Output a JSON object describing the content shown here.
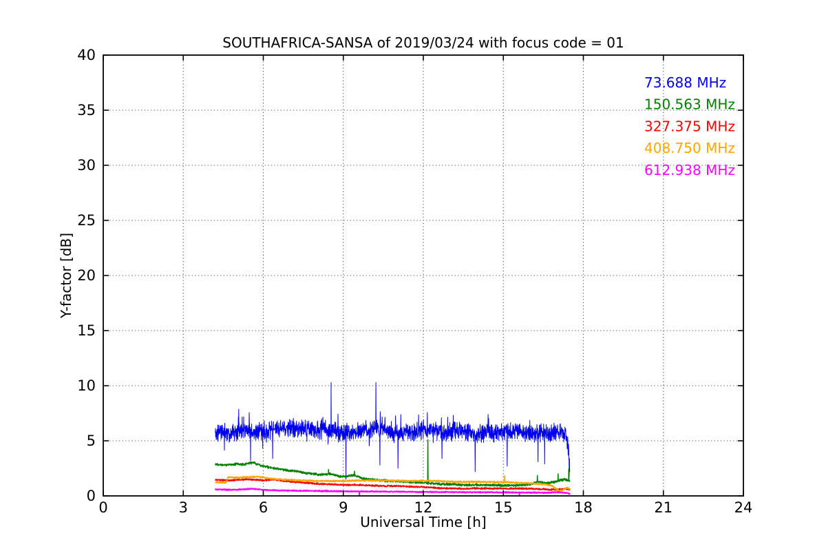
{
  "figure": {
    "background": "#ffffff",
    "axis_color": "#000000",
    "grid_color": "#4a4a4a"
  },
  "chart_data": {
    "type": "line",
    "title": "SOUTHAFRICA-SANSA of 2019/03/24 with focus code = 01",
    "xlabel": "Universal Time [h]",
    "ylabel": "Y-factor [dB]",
    "xlim": [
      0,
      24
    ],
    "ylim": [
      0,
      40
    ],
    "xticks": [
      0,
      3,
      6,
      9,
      12,
      15,
      18,
      21,
      24
    ],
    "yticks": [
      0,
      5,
      10,
      15,
      20,
      25,
      30,
      35,
      40
    ],
    "grid": true,
    "grid_style": "dotted",
    "legend": {
      "position": "top-right",
      "frame": false
    },
    "series": [
      {
        "name": "73.688 MHz",
        "color": "#0000ee",
        "line_width": 1.0,
        "x_range": [
          4.2,
          17.5
        ],
        "anchors": [
          [
            4.2,
            5.7
          ],
          [
            4.4,
            5.9
          ],
          [
            4.7,
            5.6
          ],
          [
            5.0,
            5.8
          ],
          [
            5.3,
            6.1
          ],
          [
            5.6,
            5.8
          ],
          [
            6.0,
            5.9
          ],
          [
            6.4,
            6.0
          ],
          [
            6.8,
            6.1
          ],
          [
            7.2,
            6.2
          ],
          [
            7.6,
            6.0
          ],
          [
            8.0,
            5.9
          ],
          [
            8.4,
            6.1
          ],
          [
            8.8,
            5.8
          ],
          [
            9.2,
            5.7
          ],
          [
            9.6,
            5.9
          ],
          [
            10.0,
            6.0
          ],
          [
            10.4,
            6.2
          ],
          [
            10.8,
            5.9
          ],
          [
            11.2,
            5.7
          ],
          [
            11.6,
            5.8
          ],
          [
            12.0,
            6.0
          ],
          [
            12.4,
            5.9
          ],
          [
            12.8,
            5.7
          ],
          [
            13.2,
            5.9
          ],
          [
            13.6,
            5.8
          ],
          [
            14.0,
            5.6
          ],
          [
            14.4,
            5.8
          ],
          [
            14.8,
            5.7
          ],
          [
            15.2,
            5.9
          ],
          [
            15.6,
            5.8
          ],
          [
            16.0,
            5.6
          ],
          [
            16.4,
            5.8
          ],
          [
            16.8,
            5.7
          ],
          [
            17.1,
            5.8
          ],
          [
            17.35,
            5.6
          ],
          [
            17.45,
            4.0
          ],
          [
            17.5,
            2.2
          ]
        ],
        "spikes": [
          [
            8.54,
            10.3
          ],
          [
            10.22,
            10.3
          ],
          [
            5.52,
            3.2
          ],
          [
            6.35,
            3.4
          ],
          [
            9.1,
            1.5
          ],
          [
            10.37,
            2.8
          ],
          [
            11.05,
            2.5
          ],
          [
            12.7,
            3.4
          ],
          [
            13.94,
            2.2
          ],
          [
            15.14,
            2.7
          ],
          [
            16.3,
            3.1
          ],
          [
            16.55,
            2.9
          ],
          [
            17.47,
            1.8
          ]
        ],
        "render": {
          "seed": 11,
          "points_per_hour": 140,
          "noise": 0.95,
          "burst": true
        }
      },
      {
        "name": "150.563 MHz",
        "color": "#008000",
        "line_width": 1.5,
        "x_range": [
          4.2,
          17.5
        ],
        "anchors": [
          [
            4.2,
            2.9
          ],
          [
            4.6,
            2.8
          ],
          [
            5.0,
            2.9
          ],
          [
            5.3,
            2.85
          ],
          [
            5.6,
            3.05
          ],
          [
            5.75,
            2.9
          ],
          [
            6.0,
            2.7
          ],
          [
            6.3,
            2.55
          ],
          [
            6.7,
            2.4
          ],
          [
            7.0,
            2.3
          ],
          [
            7.4,
            2.15
          ],
          [
            7.8,
            2.0
          ],
          [
            8.2,
            1.95
          ],
          [
            8.5,
            2.0
          ],
          [
            8.8,
            1.8
          ],
          [
            9.1,
            1.75
          ],
          [
            9.4,
            1.9
          ],
          [
            9.7,
            1.6
          ],
          [
            10.0,
            1.5
          ],
          [
            10.4,
            1.4
          ],
          [
            10.8,
            1.35
          ],
          [
            11.2,
            1.3
          ],
          [
            11.6,
            1.25
          ],
          [
            12.0,
            1.2
          ],
          [
            12.5,
            1.1
          ],
          [
            13.0,
            1.05
          ],
          [
            13.5,
            1.0
          ],
          [
            14.0,
            1.0
          ],
          [
            14.5,
            0.98
          ],
          [
            15.0,
            0.95
          ],
          [
            15.5,
            0.95
          ],
          [
            16.0,
            1.05
          ],
          [
            16.3,
            1.3
          ],
          [
            16.6,
            1.15
          ],
          [
            16.9,
            1.25
          ],
          [
            17.1,
            1.4
          ],
          [
            17.3,
            1.5
          ],
          [
            17.5,
            1.35
          ]
        ],
        "spikes": [
          [
            8.45,
            2.4
          ],
          [
            9.42,
            2.25
          ],
          [
            12.17,
            5.1
          ],
          [
            16.28,
            1.85
          ],
          [
            17.05,
            2.0
          ],
          [
            17.45,
            2.45
          ]
        ],
        "render": {
          "seed": 22,
          "points_per_hour": 130,
          "noise": 0.13,
          "burst": false
        }
      },
      {
        "name": "327.375 MHz",
        "color": "#ff0000",
        "line_width": 1.6,
        "x_range": [
          4.2,
          17.5
        ],
        "anchors": [
          [
            4.2,
            1.45
          ],
          [
            4.7,
            1.4
          ],
          [
            5.0,
            1.45
          ],
          [
            5.5,
            1.5
          ],
          [
            6.0,
            1.4
          ],
          [
            6.4,
            1.5
          ],
          [
            6.8,
            1.35
          ],
          [
            7.2,
            1.25
          ],
          [
            7.6,
            1.2
          ],
          [
            8.0,
            1.1
          ],
          [
            8.5,
            1.05
          ],
          [
            9.0,
            1.0
          ],
          [
            9.5,
            1.0
          ],
          [
            10.0,
            0.95
          ],
          [
            10.5,
            0.9
          ],
          [
            11.0,
            0.9
          ],
          [
            11.5,
            0.85
          ],
          [
            12.0,
            0.8
          ],
          [
            12.5,
            0.72
          ],
          [
            13.0,
            0.68
          ],
          [
            13.5,
            0.65
          ],
          [
            14.0,
            0.68
          ],
          [
            15.0,
            0.68
          ],
          [
            16.0,
            0.65
          ],
          [
            16.5,
            0.6
          ],
          [
            17.0,
            0.55
          ],
          [
            17.2,
            0.65
          ],
          [
            17.5,
            0.6
          ]
        ],
        "spikes": [],
        "render": {
          "seed": 33,
          "points_per_hour": 120,
          "noise": 0.09,
          "burst": false
        }
      },
      {
        "name": "408.750 MHz",
        "color": "#ffa500",
        "line_width": 1.8,
        "x_range": [
          4.2,
          17.5
        ],
        "anchors": [
          [
            4.2,
            1.25
          ],
          [
            4.6,
            1.2
          ],
          [
            4.68,
            1.7
          ],
          [
            5.0,
            1.65
          ],
          [
            5.5,
            1.7
          ],
          [
            5.8,
            1.75
          ],
          [
            6.2,
            1.6
          ],
          [
            6.6,
            1.5
          ],
          [
            7.0,
            1.45
          ],
          [
            7.5,
            1.4
          ],
          [
            8.0,
            1.35
          ],
          [
            8.5,
            1.35
          ],
          [
            9.0,
            1.35
          ],
          [
            9.5,
            1.4
          ],
          [
            10.0,
            1.4
          ],
          [
            10.5,
            1.4
          ],
          [
            11.0,
            1.38
          ],
          [
            11.5,
            1.35
          ],
          [
            12.0,
            1.38
          ],
          [
            12.5,
            1.35
          ],
          [
            13.0,
            1.3
          ],
          [
            13.5,
            1.28
          ],
          [
            14.0,
            1.28
          ],
          [
            14.5,
            1.25
          ],
          [
            15.0,
            1.25
          ],
          [
            15.5,
            1.2
          ],
          [
            16.0,
            1.15
          ],
          [
            16.5,
            1.05
          ],
          [
            16.8,
            0.95
          ],
          [
            17.0,
            0.6
          ],
          [
            17.1,
            0.4
          ],
          [
            17.25,
            0.55
          ],
          [
            17.4,
            0.75
          ],
          [
            17.5,
            0.6
          ]
        ],
        "spikes": [
          [
            15.05,
            1.8
          ]
        ],
        "render": {
          "seed": 44,
          "points_per_hour": 120,
          "noise": 0.08,
          "burst": false
        }
      },
      {
        "name": "612.938 MHz",
        "color": "#ff00ff",
        "line_width": 1.8,
        "x_range": [
          4.2,
          17.5
        ],
        "anchors": [
          [
            4.2,
            0.6
          ],
          [
            4.8,
            0.55
          ],
          [
            5.3,
            0.6
          ],
          [
            5.6,
            0.65
          ],
          [
            6.0,
            0.55
          ],
          [
            6.5,
            0.5
          ],
          [
            7.0,
            0.48
          ],
          [
            8.0,
            0.45
          ],
          [
            9.0,
            0.42
          ],
          [
            10.0,
            0.4
          ],
          [
            11.0,
            0.38
          ],
          [
            12.0,
            0.36
          ],
          [
            13.0,
            0.34
          ],
          [
            14.0,
            0.33
          ],
          [
            15.0,
            0.32
          ],
          [
            16.0,
            0.3
          ],
          [
            16.6,
            0.28
          ],
          [
            17.0,
            0.35
          ],
          [
            17.2,
            0.3
          ],
          [
            17.4,
            0.25
          ],
          [
            17.5,
            0.18
          ]
        ],
        "spikes": [
          [
            9.6,
            0.06
          ],
          [
            15.6,
            0.06
          ]
        ],
        "render": {
          "seed": 55,
          "points_per_hour": 120,
          "noise": 0.07,
          "burst": false
        }
      }
    ]
  }
}
